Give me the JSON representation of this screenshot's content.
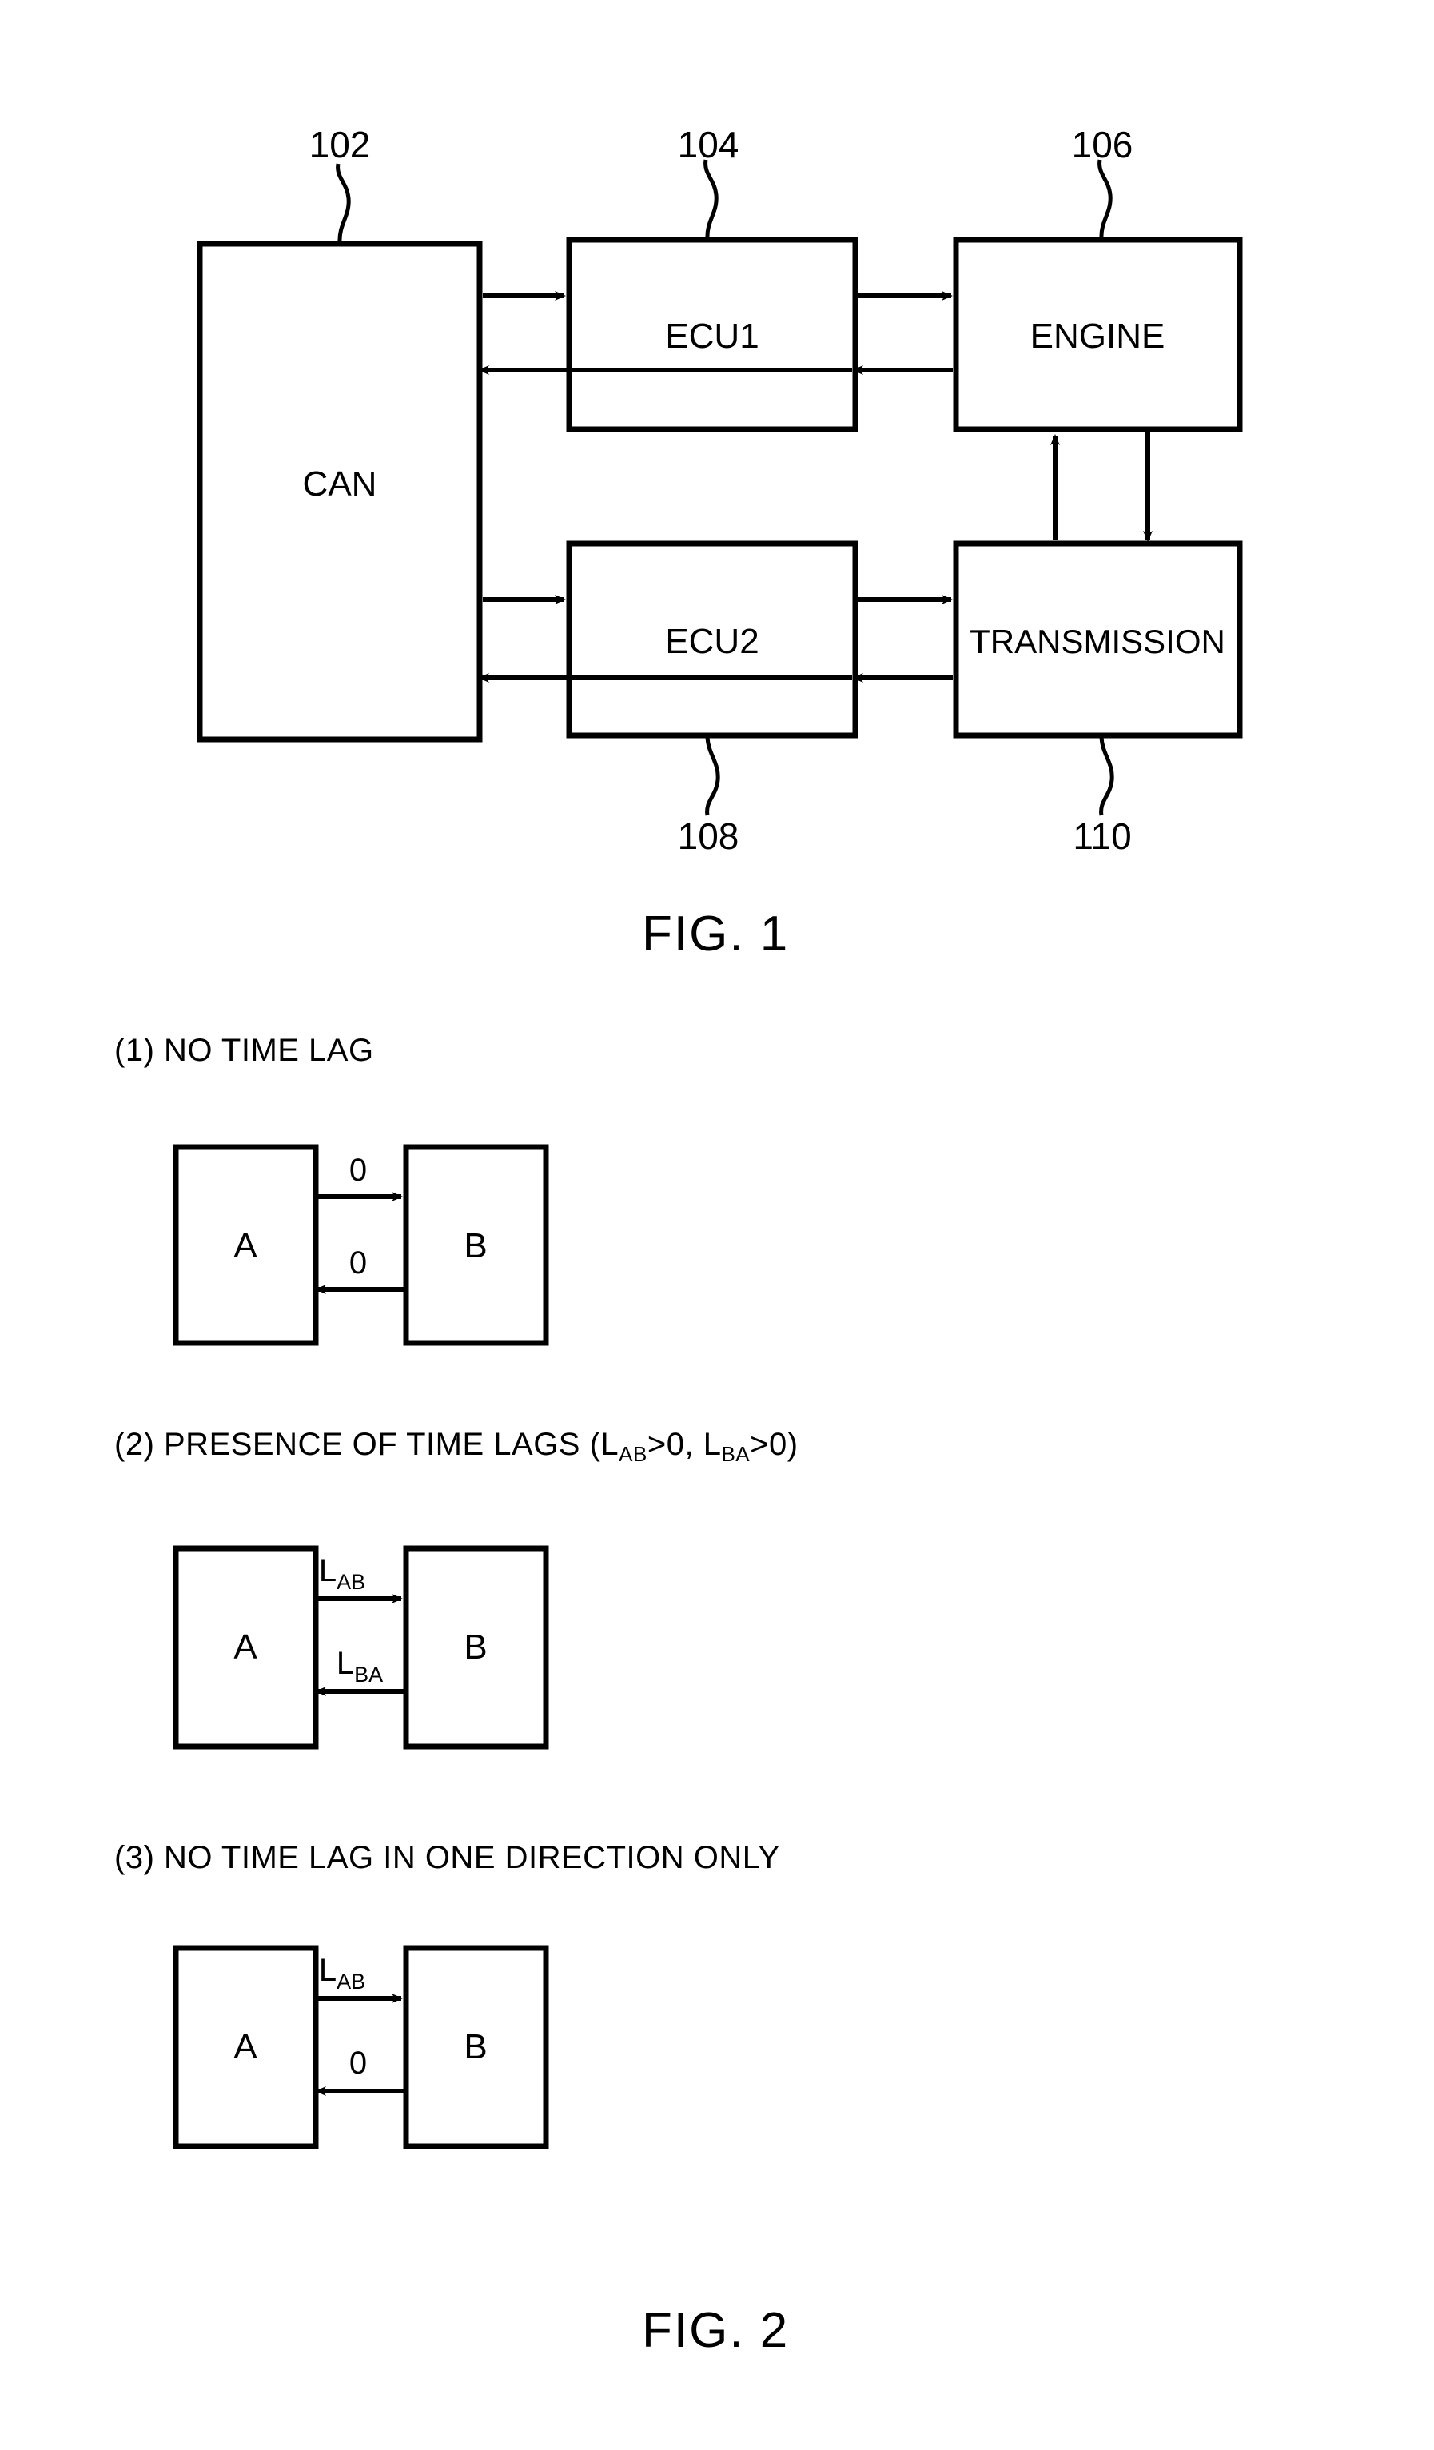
{
  "figure1": {
    "caption": "FIG. 1",
    "blocks": [
      {
        "id": "can",
        "label": "CAN",
        "ref": "102"
      },
      {
        "id": "ecu1",
        "label": "ECU1",
        "ref": "104"
      },
      {
        "id": "engine",
        "label": "ENGINE",
        "ref": "106"
      },
      {
        "id": "ecu2",
        "label": "ECU2",
        "ref": "108"
      },
      {
        "id": "transmission",
        "label": "TRANSMISSION",
        "ref": "110"
      }
    ],
    "refs": {
      "can": "102",
      "ecu1": "104",
      "engine": "106",
      "ecu2": "108",
      "transmission": "110"
    },
    "labels": {
      "can": "CAN",
      "ecu1": "ECU1",
      "engine": "ENGINE",
      "ecu2": "ECU2",
      "transmission": "TRANSMISSION"
    }
  },
  "figure2": {
    "caption": "FIG. 2",
    "sections": [
      {
        "number": "(1)",
        "title": "NO TIME LAG",
        "heading": "(1)  NO TIME LAG",
        "left_box": "A",
        "right_box": "B",
        "forward_label": "0",
        "forward_label_sub": "",
        "reverse_label": "0",
        "reverse_label_sub": ""
      },
      {
        "number": "(2)",
        "title": "PRESENCE OF TIME LAGS (LAB>0, LBA>0)",
        "heading_prefix": "(2)  PRESENCE OF TIME LAGS (L",
        "heading_sub1": "AB",
        "heading_mid": ">0, L",
        "heading_sub2": "BA",
        "heading_suffix": ">0)",
        "left_box": "A",
        "right_box": "B",
        "forward_label": "L",
        "forward_label_sub": "AB",
        "reverse_label": "L",
        "reverse_label_sub": "BA"
      },
      {
        "number": "(3)",
        "title": "NO TIME LAG IN ONE DIRECTION ONLY",
        "heading": "(3)  NO TIME LAG IN ONE DIRECTION ONLY",
        "left_box": "A",
        "right_box": "B",
        "forward_label": "L",
        "forward_label_sub": "AB",
        "reverse_label": "0",
        "reverse_label_sub": ""
      }
    ]
  },
  "style": {
    "ink": "#000000",
    "paper": "#ffffff"
  }
}
